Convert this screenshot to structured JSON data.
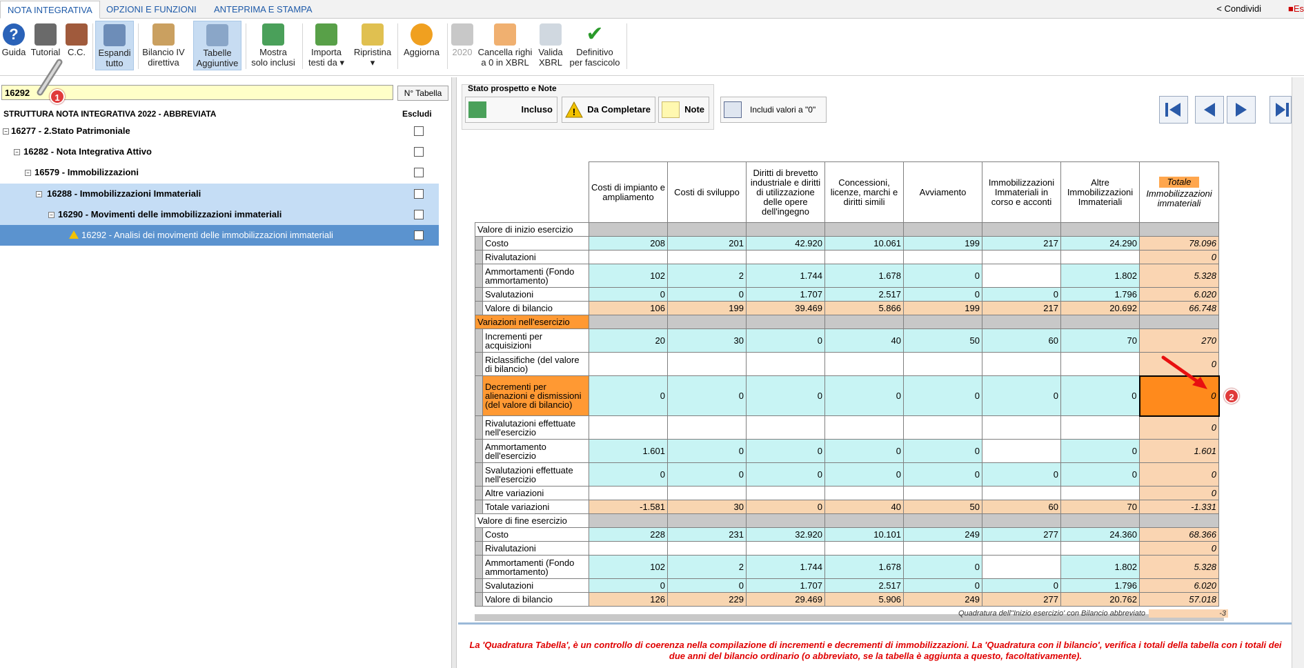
{
  "tabs": [
    "NOTA INTEGRATIVA",
    "OPZIONI E FUNZIONI",
    "ANTEPRIMA E STAMPA"
  ],
  "share_label": "Condividi",
  "es_label": "Es",
  "ribbon": [
    {
      "l1": "Guida",
      "l2": ""
    },
    {
      "l1": "Tutorial",
      "l2": ""
    },
    {
      "l1": "C.C.",
      "l2": ""
    },
    {
      "l1": "Espandi",
      "l2": "tutto"
    },
    {
      "l1": "Bilancio IV",
      "l2": "direttiva"
    },
    {
      "l1": "Tabelle",
      "l2": "Aggiuntive"
    },
    {
      "l1": "Mostra",
      "l2": "solo inclusi"
    },
    {
      "l1": "Importa",
      "l2": "testi da ▾"
    },
    {
      "l1": "Ripristina",
      "l2": "▾"
    },
    {
      "l1": "Aggiorna",
      "l2": ""
    },
    {
      "l1": "2020",
      "l2": ""
    },
    {
      "l1": "Cancella righi",
      "l2": "a 0 in XBRL"
    },
    {
      "l1": "Valida",
      "l2": "XBRL"
    },
    {
      "l1": "Definitivo",
      "l2": "per fascicolo"
    }
  ],
  "search": {
    "value": "16292",
    "button": "N° Tabella"
  },
  "tree": {
    "header": "STRUTTURA NOTA INTEGRATIVA 2022 - ABBREVIATA",
    "exclude_header": "Escludi",
    "items": [
      "16277 - 2.Stato Patrimoniale",
      "16282 - Nota Integrativa Attivo",
      "16579 - Immobilizzazioni",
      "16288 - Immobilizzazioni Immateriali",
      "16290 - Movimenti delle immobilizzazioni immateriali",
      "16292 - Analisi dei movimenti delle immobilizzazioni immateriali"
    ]
  },
  "badges": [
    "1",
    "2"
  ],
  "stato": {
    "title": "Stato prospetto e Note",
    "incluso": "Incluso",
    "da_completare": "Da Completare",
    "note": "Note",
    "includi_zero": "Includi valori a \"0\""
  },
  "table": {
    "columns": [
      "Costi di impianto e ampliamento",
      "Costi di sviluppo",
      "Diritti di brevetto industriale e diritti di utilizzazione delle opere dell'ingegno",
      "Concessioni, licenze, marchi e diritti simili",
      "Avviamento",
      "Immobilizzazioni Immateriali in corso e acconti",
      "Altre Immobilizzazioni Immateriali"
    ],
    "total_head": "Totale",
    "total_sub": "Immobilizzazioni immateriali",
    "sections": [
      {
        "title": "Valore di inizio esercizio",
        "rows": [
          {
            "label": "Costo",
            "values": [
              "208",
              "201",
              "42.920",
              "10.061",
              "199",
              "217",
              "24.290"
            ],
            "total": "78.096"
          },
          {
            "label": "Rivalutazioni",
            "values": [
              "",
              "",
              "",
              "",
              "",
              "",
              ""
            ],
            "total": "0"
          },
          {
            "label": "Ammortamenti (Fondo ammortamento)",
            "values": [
              "102",
              "2",
              "1.744",
              "1.678",
              "0",
              "",
              "1.802"
            ],
            "total": "5.328"
          },
          {
            "label": "Svalutazioni",
            "values": [
              "0",
              "0",
              "1.707",
              "2.517",
              "0",
              "0",
              "1.796"
            ],
            "total": "6.020"
          },
          {
            "label": "Valore di bilancio",
            "values": [
              "106",
              "199",
              "39.469",
              "5.866",
              "199",
              "217",
              "20.692"
            ],
            "total": "66.748"
          }
        ]
      },
      {
        "title": "Variazioni nell'esercizio",
        "rows": [
          {
            "label": "Incrementi per acquisizioni",
            "values": [
              "20",
              "30",
              "0",
              "40",
              "50",
              "60",
              "70"
            ],
            "total": "270"
          },
          {
            "label": "Riclassifiche (del valore di bilancio)",
            "values": [
              "",
              "",
              "",
              "",
              "",
              "",
              ""
            ],
            "total": "0"
          },
          {
            "label": "Decrementi per alienazioni e dismissioni (del valore di bilancio)",
            "values": [
              "0",
              "0",
              "0",
              "0",
              "0",
              "0",
              "0"
            ],
            "total": "0"
          },
          {
            "label": "Rivalutazioni effettuate nell'esercizio",
            "values": [
              "",
              "",
              "",
              "",
              "",
              "",
              ""
            ],
            "total": "0"
          },
          {
            "label": "Ammortamento dell'esercizio",
            "values": [
              "1.601",
              "0",
              "0",
              "0",
              "0",
              "",
              "0"
            ],
            "total": "1.601"
          },
          {
            "label": "Svalutazioni effettuate nell'esercizio",
            "values": [
              "0",
              "0",
              "0",
              "0",
              "0",
              "0",
              "0"
            ],
            "total": "0"
          },
          {
            "label": "Altre variazioni",
            "values": [
              "",
              "",
              "",
              "",
              "",
              "",
              ""
            ],
            "total": "0"
          },
          {
            "label": "Totale variazioni",
            "values": [
              "-1.581",
              "30",
              "0",
              "40",
              "50",
              "60",
              "70"
            ],
            "total": "-1.331"
          }
        ]
      },
      {
        "title": "Valore di fine esercizio",
        "rows": [
          {
            "label": "Costo",
            "values": [
              "228",
              "231",
              "32.920",
              "10.101",
              "249",
              "277",
              "24.360"
            ],
            "total": "68.366"
          },
          {
            "label": "Rivalutazioni",
            "values": [
              "",
              "",
              "",
              "",
              "",
              "",
              ""
            ],
            "total": "0"
          },
          {
            "label": "Ammortamenti (Fondo ammortamento)",
            "values": [
              "102",
              "2",
              "1.744",
              "1.678",
              "0",
              "",
              "1.802"
            ],
            "total": "5.328"
          },
          {
            "label": "Svalutazioni",
            "values": [
              "0",
              "0",
              "1.707",
              "2.517",
              "0",
              "0",
              "1.796"
            ],
            "total": "6.020"
          },
          {
            "label": "Valore di bilancio",
            "values": [
              "126",
              "229",
              "29.469",
              "5.906",
              "249",
              "277",
              "20.762"
            ],
            "total": "57.018"
          }
        ]
      }
    ],
    "quadratura_label": "Quadratura dell''Inizio esercizio' con Bilancio abbreviato",
    "quadratura_value": "-3"
  },
  "note": "La 'Quadratura Tabella', è un controllo di coerenza nella compilazione di incrementi e decrementi di immobilizzazioni. La 'Quadratura con il bilancio', verifica i totali della tabella con i totali dei due anni del bilancio ordinario (o abbreviato, se la tabella è aggiunta a questo, facoltativamente).",
  "colors": {
    "accent": "#1e5aa8",
    "selected_row": "#5b93cf",
    "cyan_cell": "#c8f4f4",
    "total_cell": "#fad5b2",
    "section_orange": "#ff9933",
    "note_red": "#e00000"
  }
}
